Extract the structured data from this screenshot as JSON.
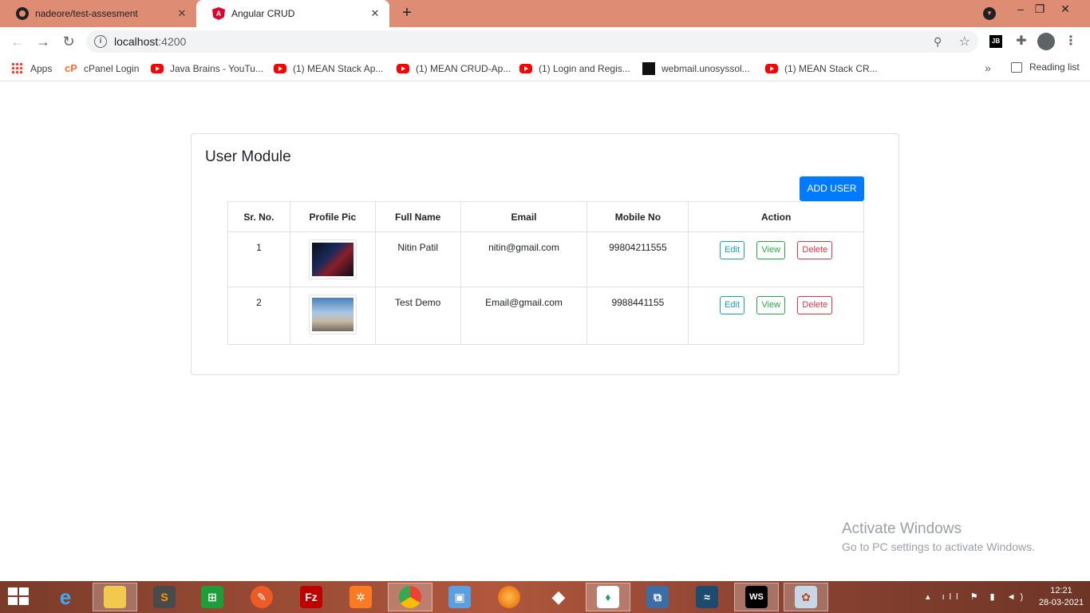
{
  "browser": {
    "tabs": [
      {
        "title": "nadeore/test-assesment",
        "icon": "github-icon"
      },
      {
        "title": "Angular CRUD",
        "icon": "angular-icon"
      }
    ],
    "url_host": "localhost",
    "url_port": ":4200",
    "bookmarks": [
      {
        "label": "Apps",
        "icon": "apps-icon"
      },
      {
        "label": "cPanel Login",
        "icon": "cpanel-icon"
      },
      {
        "label": "Java Brains - YouTu...",
        "icon": "youtube-icon"
      },
      {
        "label": "(1) MEAN Stack Ap...",
        "icon": "youtube-icon"
      },
      {
        "label": "(1) MEAN CRUD-Ap...",
        "icon": "youtube-icon"
      },
      {
        "label": "(1) Login and Regis...",
        "icon": "youtube-icon"
      },
      {
        "label": "webmail.unosyssol...",
        "icon": "webmail-icon"
      },
      {
        "label": "(1) MEAN Stack CR...",
        "icon": "youtube-icon"
      }
    ],
    "reading_list": "Reading list"
  },
  "page": {
    "title": "User Module",
    "add_button": "ADD USER",
    "columns": [
      "Sr. No.",
      "Profile Pic",
      "Full Name",
      "Email",
      "Mobile No",
      "Action"
    ],
    "rows": [
      {
        "sr": "1",
        "name": "Nitin Patil",
        "email": "nitin@gmail.com",
        "mobile": "99804211555"
      },
      {
        "sr": "2",
        "name": "Test Demo",
        "email": "Email@gmail.com",
        "mobile": "9988441155"
      }
    ],
    "actions": {
      "edit": "Edit",
      "view": "View",
      "delete": "Delete"
    }
  },
  "watermark": {
    "title": "Activate Windows",
    "subtitle": "Go to PC settings to activate Windows."
  },
  "taskbar": {
    "time": "12:21",
    "date": "28-03-2021"
  },
  "colors": {
    "tabstrip": "#de8c73",
    "primary": "#007bff",
    "edit": "#17a2b8",
    "view": "#28a745",
    "delete": "#dc3545"
  }
}
